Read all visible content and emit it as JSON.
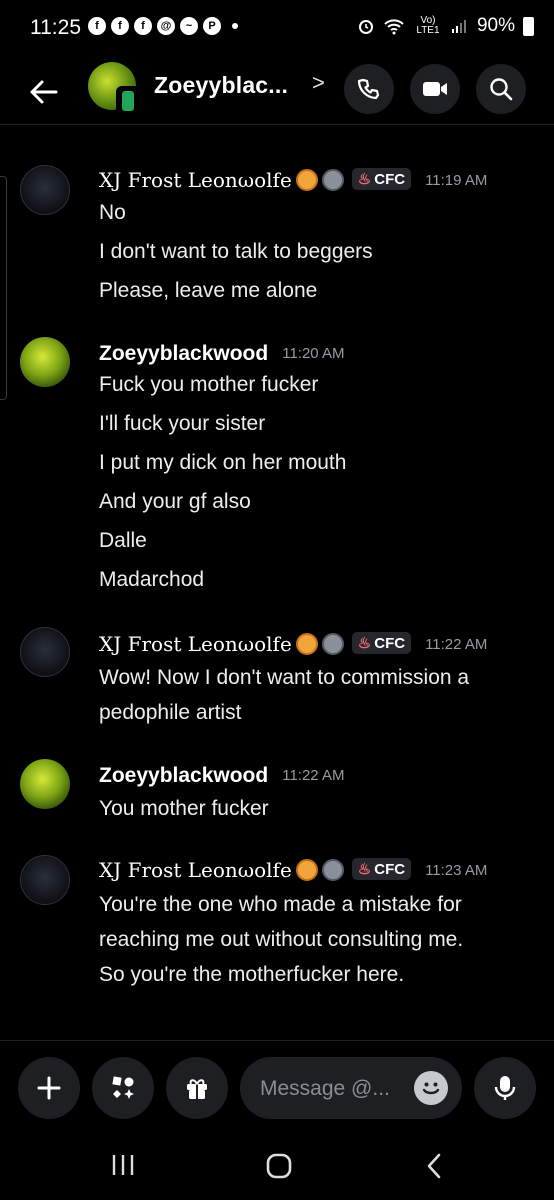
{
  "status": {
    "time": "11:25",
    "network": "Vo) LTE1",
    "battery": "90%"
  },
  "header": {
    "channel_name": "Zoeyyblac...",
    "chevron": ">",
    "icons": [
      "back-arrow-icon",
      "call-icon",
      "video-icon",
      "search-icon"
    ]
  },
  "messages": [
    {
      "author": "XJ Frost Leonωolfe",
      "tag": "CFC",
      "time": "11:19 AM",
      "lines": [
        "No",
        "I don't want to talk to beggers",
        "Please, leave me alone"
      ]
    },
    {
      "author": "Zoeyyblackwood",
      "time": "11:20 AM",
      "lines": [
        "Fuck you mother fucker",
        "I'll fuck your sister",
        "I put my dick on her mouth",
        "And your gf also",
        "Dalle",
        "Madarchod"
      ]
    },
    {
      "author": "XJ Frost Leonωolfe",
      "tag": "CFC",
      "time": "11:22 AM",
      "lines": [
        "Wow! Now I don't want to commission a",
        "pedophile artist"
      ]
    },
    {
      "author": "Zoeyyblackwood",
      "time": "11:22 AM",
      "lines": [
        "You mother fucker"
      ]
    },
    {
      "author": "XJ Frost Leonωolfe",
      "tag": "CFC",
      "time": "11:23 AM",
      "lines": [
        "You're the one who made a mistake for",
        "reaching me out without consulting me.",
        "So you're the motherfucker here."
      ]
    }
  ],
  "composer": {
    "placeholder": "Message @..."
  },
  "colors": {
    "background": "#000000",
    "surface": "#1e1f22",
    "online": "#23a55a",
    "timestamp": "#9a9aa2"
  }
}
